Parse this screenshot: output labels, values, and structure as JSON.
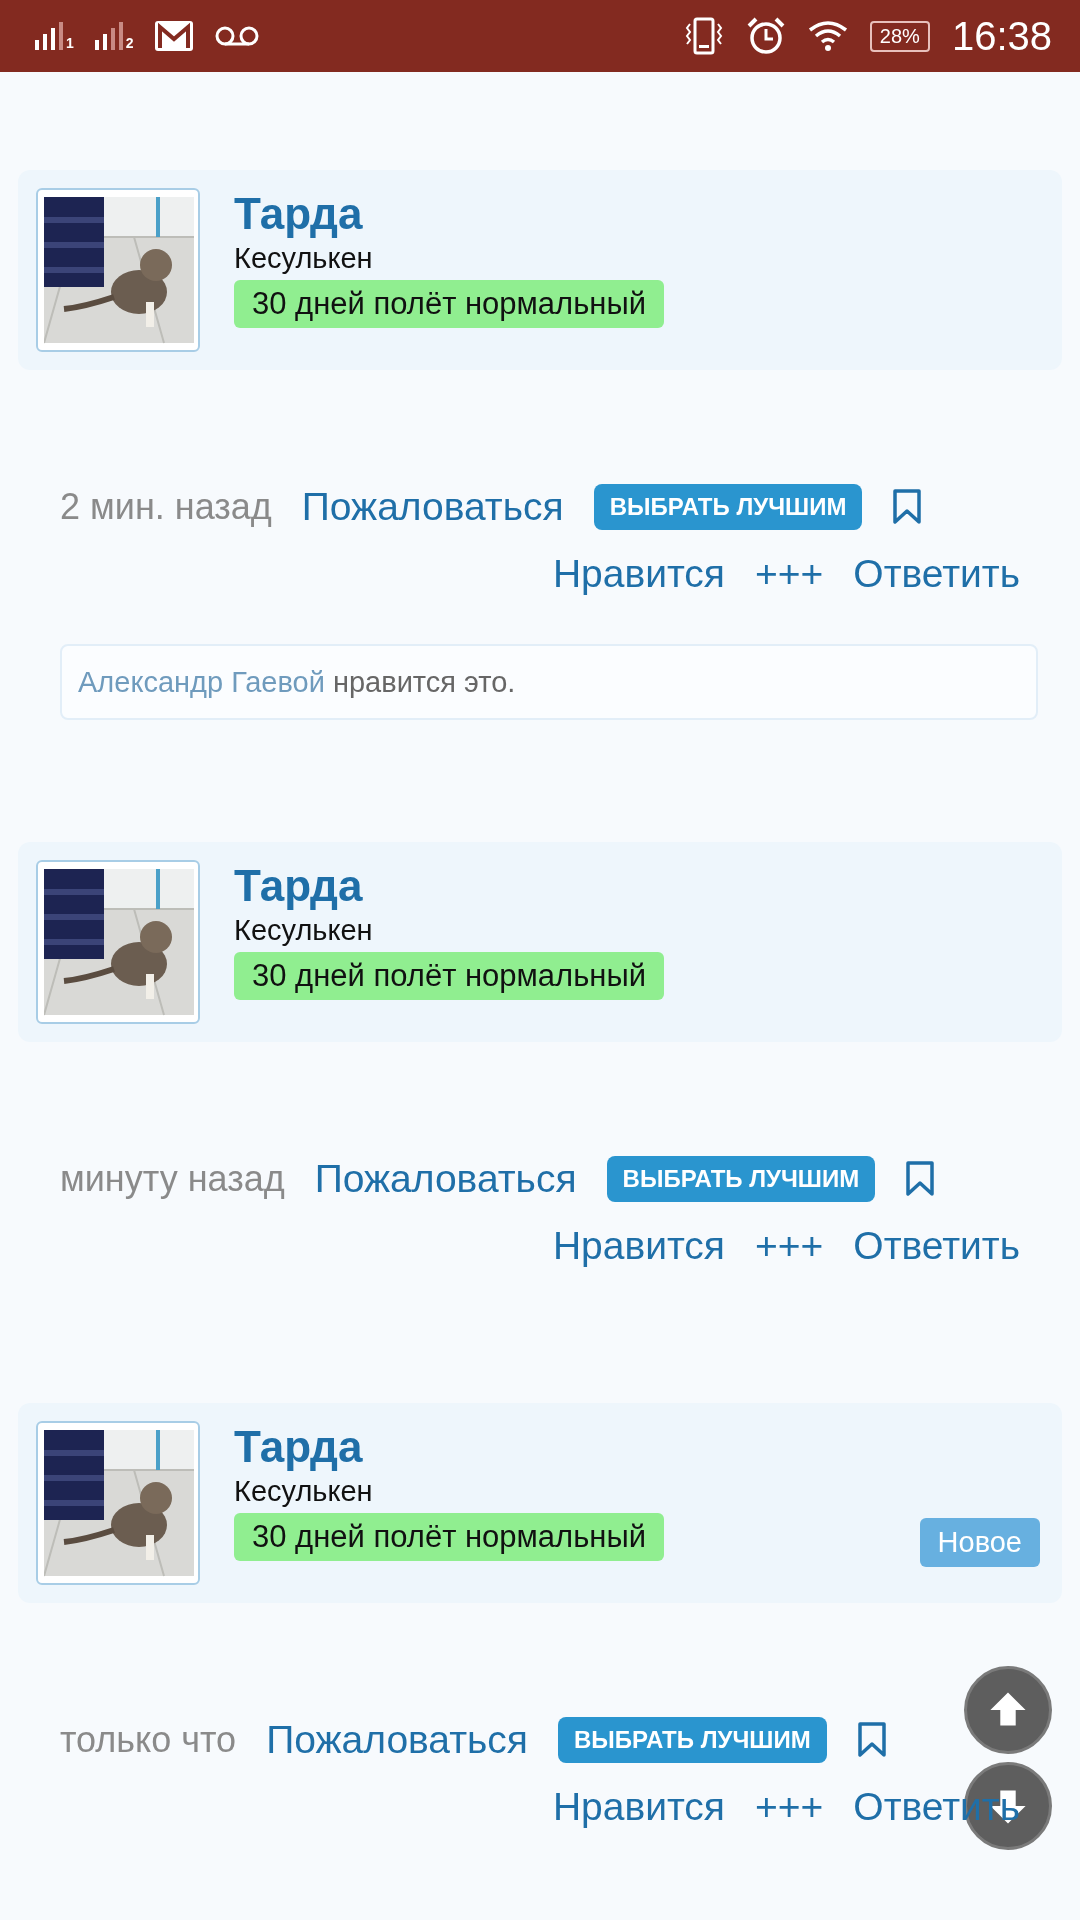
{
  "status_bar": {
    "sims": [
      {
        "label": "1"
      },
      {
        "label": "2"
      }
    ],
    "battery": "28%",
    "time": "16:38"
  },
  "posts": [
    {
      "author": "Тарда",
      "location": "Кесулькен",
      "badge": "30 дней полёт нормальный",
      "time": "2 мин. назад",
      "report": "Пожаловаться",
      "best": "ВЫБРАТЬ ЛУЧШИМ",
      "like": "Нравится",
      "plus": "+++",
      "reply": "Ответить",
      "likes": {
        "liker": "Александр Гаевой",
        "text": "нравится это."
      }
    },
    {
      "author": "Тарда",
      "location": "Кесулькен",
      "badge": "30 дней полёт нормальный",
      "time": "минуту назад",
      "report": "Пожаловаться",
      "best": "ВЫБРАТЬ ЛУЧШИМ",
      "like": "Нравится",
      "plus": "+++",
      "reply": "Ответить"
    },
    {
      "author": "Тарда",
      "location": "Кесулькен",
      "badge": "30 дней полёт нормальный",
      "new_label": "Новое",
      "time": "только что",
      "report": "Пожаловаться",
      "best": "ВЫБРАТЬ ЛУЧШИМ",
      "like": "Нравится",
      "plus": "+++",
      "reply": "Ответить"
    }
  ]
}
